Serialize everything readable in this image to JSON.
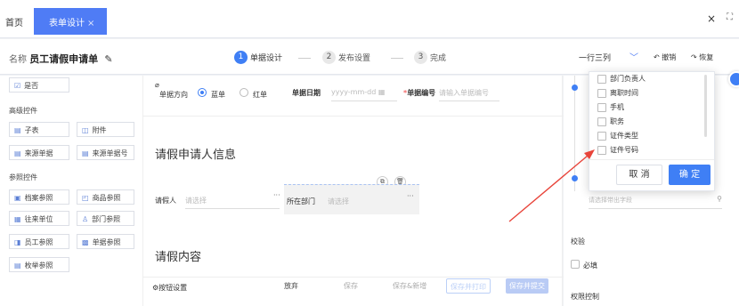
{
  "tabs": {
    "home": "首页",
    "active": "表单设计",
    "active_close": "×"
  },
  "window": {
    "close": "×",
    "fullscreen": "⛶"
  },
  "header": {
    "name_label": "名称",
    "form_name": "员工请假申请单",
    "steps": [
      {
        "num": "1",
        "label": "单据设计"
      },
      {
        "num": "2",
        "label": "发布设置"
      },
      {
        "num": "3",
        "label": "完成"
      }
    ],
    "layout": "一行三列",
    "undo": "撤销",
    "redo": "恢复"
  },
  "left": {
    "top_item": "是否",
    "advanced_title": "高级控件",
    "advanced": [
      "子表",
      "附件",
      "来源单据",
      "来源单据号"
    ],
    "ref_title": "参照控件",
    "refs": [
      "档案参照",
      "商品参照",
      "往来单位",
      "部门参照",
      "员工参照",
      "单据参照",
      "枚举参照"
    ]
  },
  "canvas": {
    "direction_label": "单据方向",
    "direction_blue": "蓝单",
    "direction_red": "红单",
    "date_label": "单据日期",
    "date_placeholder": "yyyy-mm-dd",
    "no_req": "*",
    "no_label": "单据编号",
    "no_placeholder": "请输入单据编号",
    "section1": "请假申请人信息",
    "applicant_label": "请假人",
    "applicant_placeholder": "请选择",
    "dept_label": "所在部门",
    "dept_placeholder": "请选择",
    "more": "···",
    "section2": "请假内容",
    "button_settings": "按钮设置",
    "buttons": [
      "放弃",
      "保存",
      "保存&新增",
      "保存并打印",
      "保存并提交"
    ]
  },
  "right": {
    "search_placeholder": "请选择带出字段",
    "check_title": "校验",
    "required": "必填",
    "perm_title": "权限控制"
  },
  "popup": {
    "options": [
      "部门负责人",
      "离职时间",
      "手机",
      "职务",
      "证件类型",
      "证件号码"
    ],
    "cancel": "取 消",
    "ok": "确 定"
  },
  "colors": {
    "accent": "#3f7ff5",
    "tab_active": "#4f7cf5",
    "annotation_arrow": "#e8443a"
  }
}
